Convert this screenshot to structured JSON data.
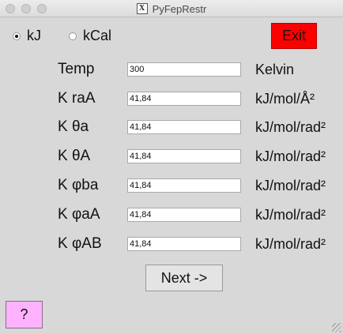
{
  "window": {
    "title": "PyFepRestr",
    "app_icon": "X"
  },
  "units": {
    "options": [
      {
        "label": "kJ",
        "checked": true
      },
      {
        "label": "kCal",
        "checked": false
      }
    ]
  },
  "buttons": {
    "exit": "Exit",
    "next": "Next ->",
    "help": "?"
  },
  "colors": {
    "exit_bg": "#ff0000",
    "help_bg": "#ffb3ff"
  },
  "fields": [
    {
      "label": "Temp",
      "value": "300",
      "unit": "Kelvin"
    },
    {
      "label": "K raA",
      "value": "41,84",
      "unit": "kJ/mol/Å²"
    },
    {
      "label": "K θa",
      "value": "41,84",
      "unit": "kJ/mol/rad²"
    },
    {
      "label": "K θA",
      "value": "41,84",
      "unit": "kJ/mol/rad²"
    },
    {
      "label": "K φba",
      "value": "41,84",
      "unit": "kJ/mol/rad²"
    },
    {
      "label": "K φaA",
      "value": "41,84",
      "unit": "kJ/mol/rad²"
    },
    {
      "label": "K φAB",
      "value": "41,84",
      "unit": "kJ/mol/rad²"
    }
  ]
}
